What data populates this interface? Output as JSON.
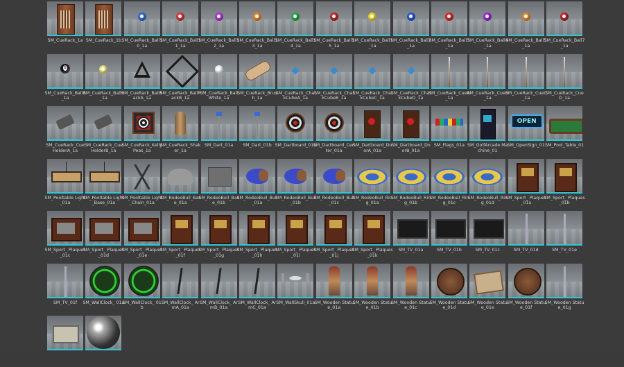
{
  "assets": [
    {
      "name": "SM_CueRack_1a",
      "icon": "cue-cabinet-icon"
    },
    {
      "name": "SM_CueRack_1b",
      "icon": "cue-cabinet-icon"
    },
    {
      "name": "SM_CueRack_Ball10_1a",
      "icon": "pool-ball-icon",
      "color": "#3a6ad4"
    },
    {
      "name": "SM_CueRack_Ball11_1a",
      "icon": "pool-ball-icon",
      "color": "#d43a3a"
    },
    {
      "name": "SM_CueRack_Ball12_1a",
      "icon": "pool-ball-icon",
      "color": "#b03ad4"
    },
    {
      "name": "SM_CueRack_Ball13_1a",
      "icon": "pool-ball-icon",
      "color": "#e8862a"
    },
    {
      "name": "SM_CueRack_Ball14_1a",
      "icon": "pool-ball-icon",
      "color": "#2aa84a"
    },
    {
      "name": "SM_CueRack_Ball15_1a",
      "icon": "pool-ball-icon",
      "color": "#c02a2a"
    },
    {
      "name": "SM_CueRack_Ball1_1a",
      "icon": "pool-ball-icon",
      "color": "#e8d42a"
    },
    {
      "name": "SM_CueRack_Ball2_1a",
      "icon": "pool-ball-icon",
      "color": "#2a5ad4"
    },
    {
      "name": "SM_CueRack_Ball3_1a",
      "icon": "pool-ball-icon",
      "color": "#d42a2a"
    },
    {
      "name": "SM_CueRack_Ball4_1a",
      "icon": "pool-ball-icon",
      "color": "#9a2ad4"
    },
    {
      "name": "SM_CueRack_Ball5_1a",
      "icon": "pool-ball-icon",
      "color": "#e8882a"
    },
    {
      "name": "SM_CueRack_Ball7_1a",
      "icon": "pool-ball-icon",
      "color": "#b8282a"
    },
    {
      "name": "SM_CueRack_Ball8_1a",
      "icon": "eight-ball-icon"
    },
    {
      "name": "SM_CueRack_Ball9_1a",
      "icon": "pool-ball-icon",
      "color": "#e8e07a"
    },
    {
      "name": "SM_CueRack_BallRackA_1a",
      "icon": "ball-rack-triangle-icon"
    },
    {
      "name": "SM_CueRack_BallRackB_1a",
      "icon": "ball-rack-diamond-icon"
    },
    {
      "name": "SM_CueRack_BallWhite_1a",
      "icon": "pool-ball-icon",
      "color": "#f2f2f2"
    },
    {
      "name": "SM_CueRack_Brush_1a",
      "icon": "brush-icon"
    },
    {
      "name": "SM_CueRack_ChalkCubeA_1a",
      "icon": "chalk-cube-icon"
    },
    {
      "name": "SM_CueRack_ChalkCubeB_1a",
      "icon": "chalk-cube-icon"
    },
    {
      "name": "SM_CueRack_ChalkCubeC_1a",
      "icon": "chalk-cube-icon"
    },
    {
      "name": "SM_CueRack_ChalkCubeD_1a",
      "icon": "chalk-cube-icon"
    },
    {
      "name": "SM_CueRack_CueA_1a",
      "icon": "cue-stick-icon"
    },
    {
      "name": "SM_CueRack_CueB_1a",
      "icon": "cue-stick-icon"
    },
    {
      "name": "SM_CueRack_CueC_1a",
      "icon": "cue-stick-icon"
    },
    {
      "name": "SM_CueRack_CueD_1a",
      "icon": "cue-stick-icon"
    },
    {
      "name": "SM_CueRack_CueHolderA_1a",
      "icon": "cue-holder-icon"
    },
    {
      "name": "SM_CueRack_CueHolderB_1a",
      "icon": "cue-holder-icon"
    },
    {
      "name": "SM_CueRack_KellyPeas_1a",
      "icon": "kelly-peas-board-icon"
    },
    {
      "name": "SM_CueRack_Shaker_1a",
      "icon": "shaker-bottle-icon"
    },
    {
      "name": "SM_Dart_01a",
      "icon": "dart-icon"
    },
    {
      "name": "SM_Dart_01b",
      "icon": "dart-icon"
    },
    {
      "name": "SM_Dartboard_01a",
      "icon": "dartboard-cabinet-icon"
    },
    {
      "name": "SM_Dartboard_Center_01a",
      "icon": "dartboard-icon"
    },
    {
      "name": "SM_Dartboard_DoorA_01a",
      "icon": "cabinet-door-icon"
    },
    {
      "name": "SM_Dartboard_DoorB_01a",
      "icon": "cabinet-door-icon"
    },
    {
      "name": "SM_Flags_01a",
      "icon": "flags-icon"
    },
    {
      "name": "SM_GolfArcade Machine_01",
      "icon": "arcade-machine-icon"
    },
    {
      "name": "SM_OpenSign_01",
      "icon": "neon-sign-icon",
      "sign_text": "OPEN"
    },
    {
      "name": "SM_Pool_Table_01",
      "icon": "pool-table-icon"
    },
    {
      "name": "SM_Pooltable Light_01a",
      "icon": "table-light-icon"
    },
    {
      "name": "SM_Pooltable Light_Base_01a",
      "icon": "table-light-icon"
    },
    {
      "name": "SM_Pooltable Light_Chain_01a",
      "icon": "light-chain-icon"
    },
    {
      "name": "SM_RodeoBull_Base_01a",
      "icon": "bull-base-icon"
    },
    {
      "name": "SM_RodeoBull_Base_01b",
      "icon": "block-icon"
    },
    {
      "name": "SM_RodeoBull_Bull_01a",
      "icon": "rodeo-bull-icon"
    },
    {
      "name": "SM_RodeoBull_Bull_01b",
      "icon": "rodeo-bull-icon"
    },
    {
      "name": "SM_RodeoBull_Bull_01c",
      "icon": "rodeo-bull-icon"
    },
    {
      "name": "SM_RodeoBull_Ring_01a",
      "icon": "inflatable-ring-icon"
    },
    {
      "name": "SM_RodeoBull_Ring_01b",
      "icon": "inflatable-ring-icon"
    },
    {
      "name": "SM_RodeoBull_Ring_01c",
      "icon": "inflatable-ring-icon"
    },
    {
      "name": "SM_RodeoBull_Ring_01d",
      "icon": "inflatable-ring-icon"
    },
    {
      "name": "SM_Sport_ Plaques_01a",
      "icon": "plaque-icon"
    },
    {
      "name": "SM_Sport_ Plaques_01b",
      "icon": "plaque-icon"
    },
    {
      "name": "SM_Sport_ Plaques_01c",
      "icon": "wide-plaque-icon"
    },
    {
      "name": "SM_Sport_ Plaques_01d",
      "icon": "wide-plaque-icon"
    },
    {
      "name": "SM_Sport_ Plaques_01e",
      "icon": "wide-plaque-icon"
    },
    {
      "name": "SM_Sport_ Plaques_01f",
      "icon": "plaque-icon"
    },
    {
      "name": "SM_Sport_ Plaques_01g",
      "icon": "plaque-icon"
    },
    {
      "name": "SM_Sport_ Plaques_01h",
      "icon": "plaque-icon"
    },
    {
      "name": "SM_Sport_ Plaques_01i",
      "icon": "plaque-icon"
    },
    {
      "name": "SM_Sport_ Plaques_01j",
      "icon": "plaque-icon"
    },
    {
      "name": "SM_Sport_ Plaques_01k",
      "icon": "plaque-icon"
    },
    {
      "name": "SM_TV_01a",
      "icon": "tv-icon"
    },
    {
      "name": "SM_TV_01b",
      "icon": "tv-icon"
    },
    {
      "name": "SM_TV_01c",
      "icon": "tv-icon"
    },
    {
      "name": "SM_TV_01d",
      "icon": "tv-mount-pole-icon"
    },
    {
      "name": "SM_TV_01e",
      "icon": "tv-mount-pole-icon"
    },
    {
      "name": "SM_TV_01f",
      "icon": "tv-mount-pole-icon"
    },
    {
      "name": "SM_WallClock_ 01a",
      "icon": "wall-clock-icon"
    },
    {
      "name": "SM_WallClock_ 01b",
      "icon": "wall-clock-icon"
    },
    {
      "name": "SM_WallClock_ ArmA_01a",
      "icon": "clock-arm-icon"
    },
    {
      "name": "SM_WallClock_ ArmB_01a",
      "icon": "clock-arm-icon"
    },
    {
      "name": "SM_WallClock_ ArmC_01a",
      "icon": "clock-arm-icon"
    },
    {
      "name": "SM_WallSkull_01a",
      "icon": "wall-skull-icon"
    },
    {
      "name": "SM_Wooden Statue_01a",
      "icon": "wooden-statue-icon"
    },
    {
      "name": "SM_Wooden Statue_01b",
      "icon": "wooden-statue-icon"
    },
    {
      "name": "SM_Wooden Statue_01c",
      "icon": "wooden-statue-icon"
    },
    {
      "name": "SM_Wooden Statue_01d",
      "icon": "headdress-icon"
    },
    {
      "name": "SM_Wooden Statue_01e",
      "icon": "crate-icon"
    },
    {
      "name": "SM_Wooden Statue_01f",
      "icon": "round-base-icon"
    },
    {
      "name": "SM_Wooden Statue_01g",
      "icon": "spear-icon"
    },
    {
      "name": "",
      "icon": "laptop-icon"
    },
    {
      "name": "",
      "icon": "chrome-sphere-icon"
    }
  ],
  "accent_color": "#2fc6d8"
}
